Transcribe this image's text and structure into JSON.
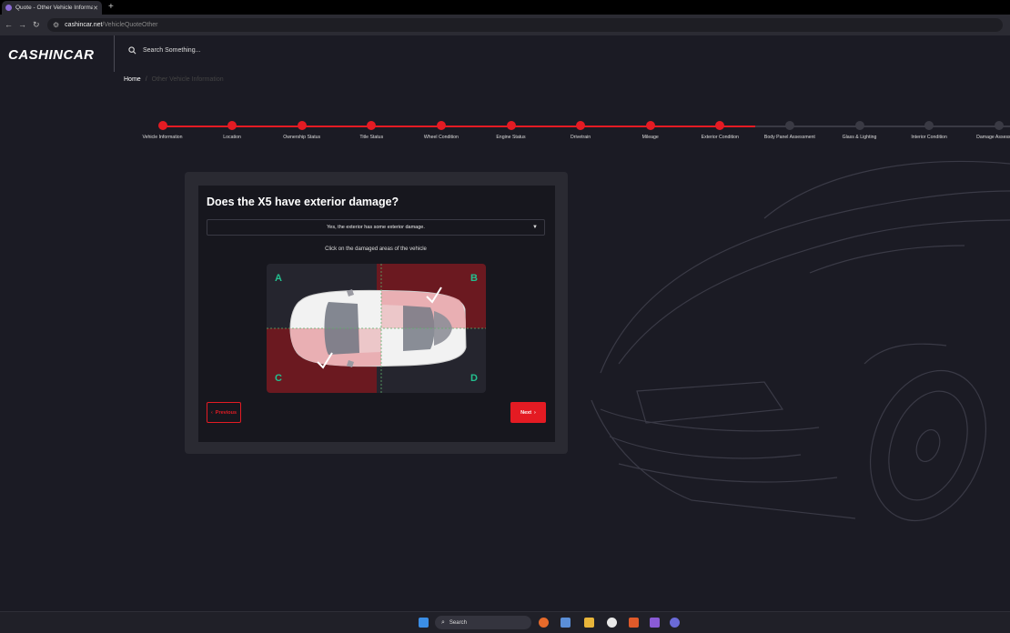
{
  "browser": {
    "tab_title": "Quote - Other Vehicle Informati",
    "tab_close": "✕",
    "new_tab": "+",
    "url_host": "cashincar.net",
    "url_path": "/VehicleQuoteOther"
  },
  "header": {
    "logo": "CASHINCAR",
    "search_placeholder": "Search Something..."
  },
  "breadcrumb": {
    "home": "Home",
    "separator": "/",
    "current": "Other Vehicle Information"
  },
  "stepper": {
    "steps": [
      {
        "label": "Vehicle Information",
        "done": true
      },
      {
        "label": "Location",
        "done": true
      },
      {
        "label": "Ownership Status",
        "done": true
      },
      {
        "label": "Title Status",
        "done": true
      },
      {
        "label": "Wheel Condition",
        "done": true
      },
      {
        "label": "Engine Status",
        "done": true
      },
      {
        "label": "Drivetrain",
        "done": true
      },
      {
        "label": "Mileage",
        "done": true
      },
      {
        "label": "Exterior Condition",
        "done": true
      },
      {
        "label": "Body Panel Assessment",
        "done": false
      },
      {
        "label": "Glass & Lighting",
        "done": false
      },
      {
        "label": "Interior Condition",
        "done": false
      },
      {
        "label": "Damage Assessment",
        "done": false
      }
    ]
  },
  "form": {
    "question": "Does the X5 have exterior damage?",
    "selected_option": "Yes, the exterior has some exterior damage.",
    "hint": "Click on the damaged areas of the vehicle",
    "zones": [
      {
        "label": "A",
        "selected": false
      },
      {
        "label": "B",
        "selected": true
      },
      {
        "label": "C",
        "selected": true
      },
      {
        "label": "D",
        "selected": false
      }
    ],
    "previous_label": "Previous",
    "next_label": "Next"
  },
  "taskbar": {
    "search_label": "Search"
  },
  "colors": {
    "accent": "#e41b23",
    "zone_selected": "#6b1920",
    "zone_unselected": "#25252e",
    "zone_label": "#23c08f",
    "step_pending": "#3a3a44"
  }
}
